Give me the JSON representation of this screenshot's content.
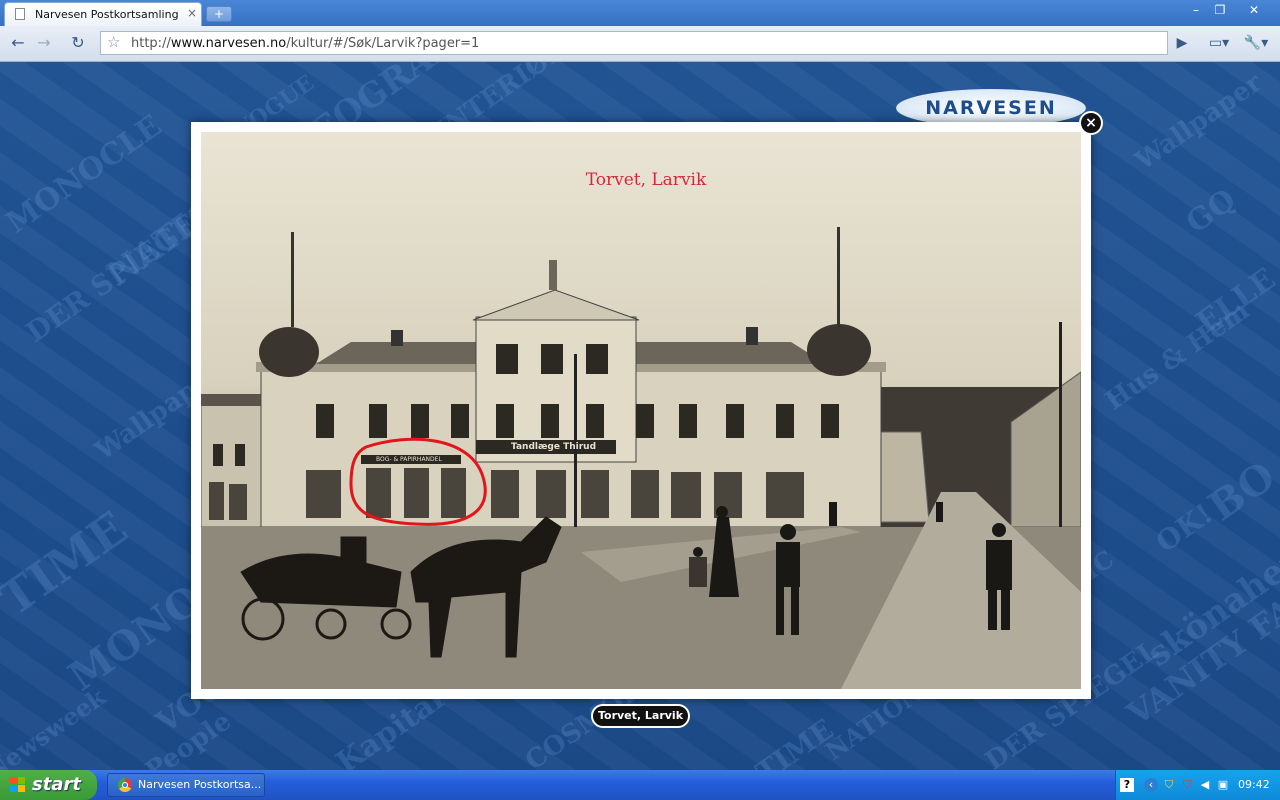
{
  "browser": {
    "tab_title": "Narvesen Postkortsamling",
    "tab_close": "×",
    "new_tab": "+",
    "window_buttons": {
      "minimize": "–",
      "restore": "❐",
      "close": "✕"
    },
    "nav": {
      "back": "←",
      "forward": "→",
      "reload": "↻",
      "star": "☆"
    },
    "url": {
      "scheme": "http://",
      "host": "www.narvesen.no",
      "path": "/kultur/#/Søk/Larvik?pager=1"
    },
    "right_buttons": {
      "go": "▶",
      "page_menu": "▭▾",
      "tools_menu": "🔧▾"
    }
  },
  "page": {
    "logo_text": "NARVESEN",
    "close_button": "×",
    "postcard_title": "Torvet, Larvik",
    "shop_sign": "BOG- & PAPIRHANDEL",
    "dental_sign": "Tandlæge Thirud",
    "caption": "Torvet, Larvik",
    "background_words": [
      "TIME",
      "DER SPIEGEL",
      "Wallpaper",
      "MONOCLE",
      "VOGUE",
      "NATIONAL GEOGRAPHIC",
      "Hus & Hem",
      "skönahem",
      "GQ",
      "OK!",
      "ELLE",
      "VANITY FAIR",
      "INTERIØR",
      "Kapital",
      "COSMOPOLITAN",
      "Newsweek",
      "BO",
      "People"
    ]
  },
  "taskbar": {
    "start_label": "start",
    "task_item": "Narvesen Postkortsa...",
    "clock": "09:42"
  },
  "colors": {
    "desktop_blue": "#1d4f8e",
    "highlight_red": "#e0161a",
    "postcard_title_red": "#d6283a"
  }
}
